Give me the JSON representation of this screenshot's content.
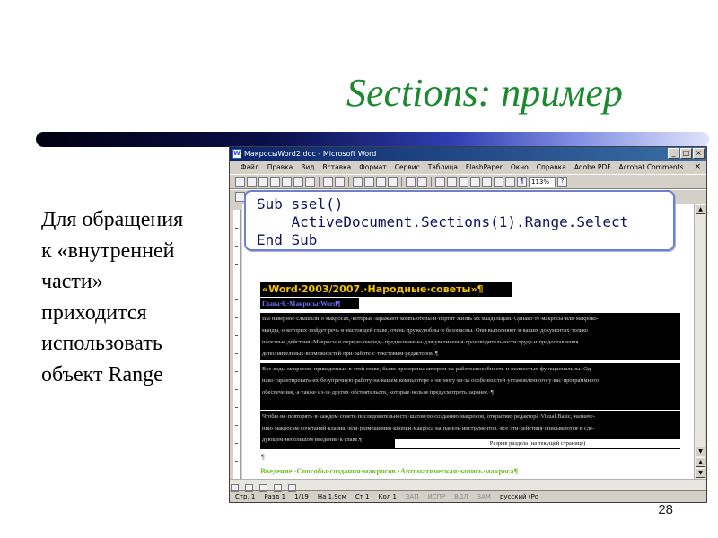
{
  "slide": {
    "title": "Sections: пример",
    "body_lines": [
      "Для обращения",
      "к «внутренней",
      "части»",
      "приходится",
      "использовать",
      "объект Range"
    ],
    "page_number": "28"
  },
  "colors": {
    "title": "#1b8a2e",
    "code_border": "#6d7fd4",
    "heading_yellow": "#f5c400",
    "intro_green": "#6dbf1f"
  },
  "word_window": {
    "title": "МакросыWord2.doc - Microsoft Word",
    "menu": [
      "Файл",
      "Правка",
      "Вид",
      "Вставка",
      "Формат",
      "Сервис",
      "Таблица",
      "FlashPaper",
      "Окно",
      "Справка",
      "Adobe PDF",
      "Acrobat Comments"
    ],
    "zoom": "113%",
    "code": [
      "Sub ssel()",
      "    ActiveDocument.Sections(1).Range.Select",
      "End Sub"
    ],
    "doc_heading": "«Word·2003/2007.·Народные·советы»¶",
    "chapter": "Глава·6.·Макросы·Word¶",
    "para1": [
      "Вы·наверное·слышали·о·макросах,·которые·заражают·компьютеры·и·портят·жизнь·их·владельцам.·Однако·те·макросы·или·макроко-",
      "манды,·о·которых·пойдет·речь·в·настоящей·главе,·очень·дружелюбны·и·безопасны.·Они·выполняют·в·ваших·документах·только",
      "полезные·действия.·Макросы·в·первую·очередь·предназначены·для·увеличения·производительности·труда·и·предоставления",
      "дополнительных·возможностей·при·работе·с·текстовым·редактором.¶"
    ],
    "para2": [
      "Все·коды·макросов,·приведенные·в·этой·главе,·были·проверены·автором·на·работоспособность·и·полностью·функциональны.·Од-",
      "нако·гарантировать·их·безупречную·работу·на·вашем·компьютере·я·не·могу·из-за·особенностей·установленного·у·вас·программного",
      "обеспечения,·а·также·из-за·других·обстоятельств,·которые·нельзя·предусмотреть·заранее.·¶"
    ],
    "para3": [
      "Чтобы·не·повторять·в·каждом·совете·последовательность·шагов·по·созданию·макросов,·открытию·редактора·Visual·Basic,·назначе-",
      "нию·макросам·сочетаний·клавиш·или·размещению·кнопки·макроса·на·панель·инструментов,·все·эти·действия·описываются·в·сле-",
      "дующем·небольшом·введении·к·главе.¶"
    ],
    "section_break": "Разрыв раздела (на текущей странице)",
    "pilcrow": "¶",
    "intro": "Введение.·Способы·создания·макросов.·Автоматическая·запись·макроса¶",
    "status": {
      "page": "Стр. 1",
      "section": "Разд 1",
      "pages": "1/19",
      "at": "На 1,9см",
      "line": "Ст 1",
      "col": "Кол 1",
      "rec": "ЗАП",
      "trk": "ИСПР",
      "ext": "ВДЛ",
      "ovr": "ЗАМ",
      "lang": "русский (Ро"
    }
  }
}
